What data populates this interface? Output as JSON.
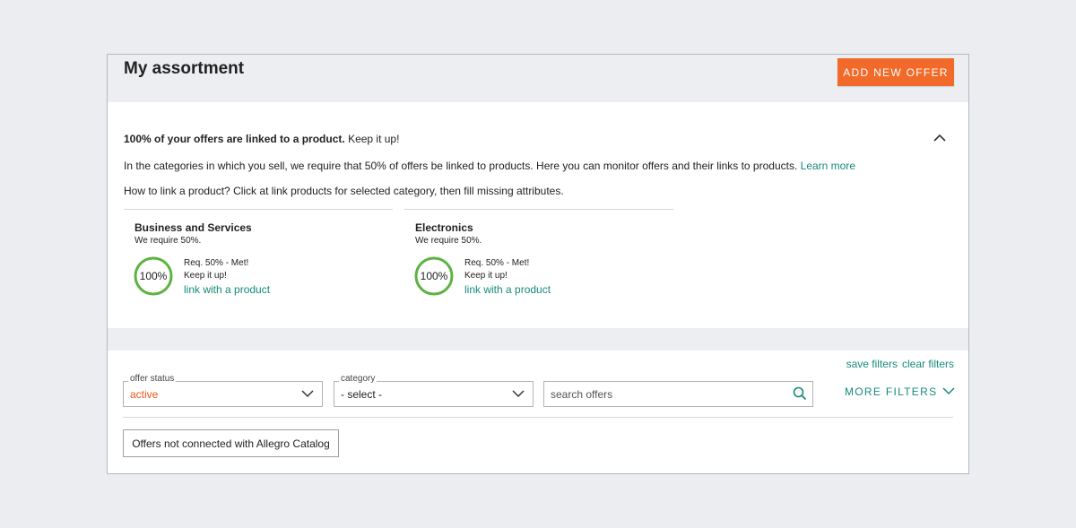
{
  "header": {
    "title": "My assortment",
    "add_offer_label": "ADD NEW OFFER"
  },
  "info": {
    "headline_bold": "100% of your offers are linked to a product.",
    "headline_rest": " Keep it up!",
    "line1_text": "In the categories in which you sell, we require that 50% of offers be linked to products. Here you can monitor offers and their links to products. ",
    "learn_more": "Learn more",
    "line2_text": "How to link a product? Click at link products for selected category, then fill missing attributes."
  },
  "categories": [
    {
      "title": "Business and Services",
      "requirement": "We require 50%.",
      "percent_label": "100%",
      "progress": 1.0,
      "status": "Req. 50% - Met!",
      "encouragement": "Keep it up!",
      "link": "link with a product"
    },
    {
      "title": "Electronics",
      "requirement": "We require 50%.",
      "percent_label": "100%",
      "progress": 1.0,
      "status": "Req. 50% - Met!",
      "encouragement": "Keep it up!",
      "link": "link with a product"
    }
  ],
  "filters": {
    "save_filters": "save filters",
    "clear_filters": "clear filters",
    "offer_status": {
      "legend": "offer status",
      "value": "active"
    },
    "category": {
      "legend": "category",
      "value": "- select -"
    },
    "search": {
      "placeholder": "search offers"
    },
    "more_filters": "MORE FILTERS",
    "not_connected_button": "Offers not connected with Allegro Catalog"
  },
  "colors": {
    "accent": "#f16a29",
    "link": "#168a7a",
    "progress": "#5db342",
    "active_value": "#e8581c"
  }
}
